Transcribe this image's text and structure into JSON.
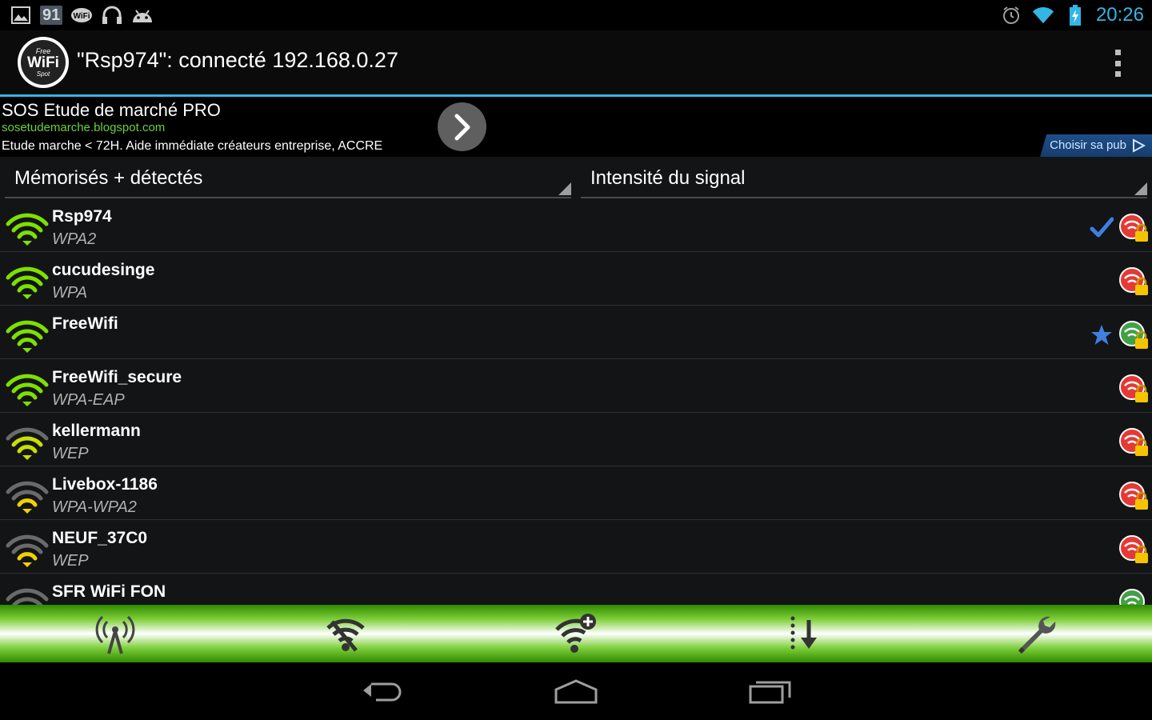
{
  "status_bar": {
    "badge": "91",
    "time": "20:26",
    "time_color": "#33b5e5",
    "left_icons": [
      "picture-icon",
      "badge-91",
      "wifi-app-icon",
      "headphones-icon",
      "android-icon"
    ],
    "right_icons": [
      "alarm-icon",
      "wifi-signal-icon",
      "battery-charging-icon"
    ]
  },
  "action_bar": {
    "logo": {
      "top": "Free",
      "main": "WiFi",
      "bottom": "Spot"
    },
    "title": "\"Rsp974\": connecté 192.168.0.27",
    "accent_color": "#33b5e5"
  },
  "ad": {
    "title": "SOS Etude de marché PRO",
    "url": "sosetudemarche.blogspot.com",
    "description": "Etude marche < 72H. Aide immédiate créateurs entreprise, ACCRE",
    "choose_label": "Choisir sa pub",
    "url_color": "#6ccf3a"
  },
  "filters": {
    "left_spinner": "Mémorisés + détectés",
    "right_spinner": "Intensité du signal"
  },
  "networks": [
    {
      "name": "Rsp974",
      "security": "WPA2",
      "signal_color": "#7ee000",
      "signal_level": 4,
      "status": "locked-red",
      "mark": "check"
    },
    {
      "name": "cucudesinge",
      "security": "WPA",
      "signal_color": "#7ee000",
      "signal_level": 4,
      "status": "locked-red",
      "mark": ""
    },
    {
      "name": "FreeWifi",
      "security": "",
      "signal_color": "#7ee000",
      "signal_level": 4,
      "status": "locked-green",
      "mark": "star"
    },
    {
      "name": "FreeWifi_secure",
      "security": "WPA-EAP",
      "signal_color": "#7ee000",
      "signal_level": 4,
      "status": "locked-red",
      "mark": ""
    },
    {
      "name": "kellermann",
      "security": "WEP",
      "signal_color": "#c8e000",
      "signal_level": 3,
      "status": "locked-red",
      "mark": ""
    },
    {
      "name": "Livebox-1186",
      "security": "WPA-WPA2",
      "signal_color": "#f0d000",
      "signal_level": 2,
      "status": "locked-red",
      "mark": ""
    },
    {
      "name": "NEUF_37C0",
      "security": "WEP",
      "signal_color": "#f0d000",
      "signal_level": 2,
      "status": "locked-red",
      "mark": ""
    },
    {
      "name": "SFR WiFi FON",
      "security": "",
      "signal_color": "#f0d000",
      "signal_level": 1,
      "status": "open-green",
      "mark": ""
    }
  ],
  "bottom_bar": {
    "buttons": [
      "antenna-icon",
      "wifi-off-icon",
      "wifi-add-icon",
      "sort-down-icon",
      "wrench-icon"
    ]
  },
  "nav_bar": {
    "buttons": [
      "back-icon",
      "home-icon",
      "recents-icon"
    ]
  }
}
